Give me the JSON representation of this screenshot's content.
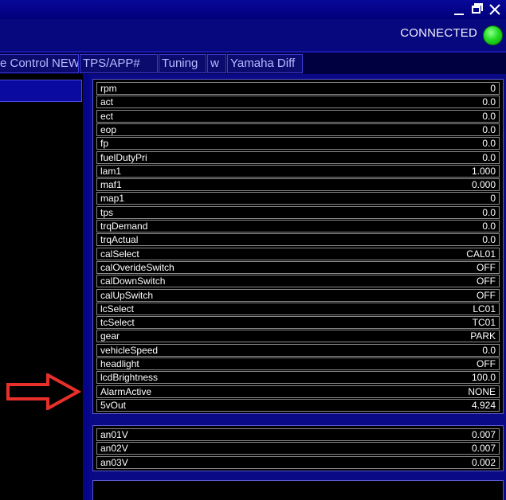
{
  "header": {
    "status_text": "CONNECTED",
    "status_color": "#22dd22"
  },
  "tabs": [
    {
      "label": "e Control NEW"
    },
    {
      "label": "TPS/APP#"
    },
    {
      "label": "Tuning"
    },
    {
      "label": "w"
    },
    {
      "label": "Yamaha Diff"
    }
  ],
  "channels": [
    {
      "name": "rpm",
      "value": "0"
    },
    {
      "name": "act",
      "value": "0.0"
    },
    {
      "name": "ect",
      "value": "0.0"
    },
    {
      "name": "eop",
      "value": "0.0"
    },
    {
      "name": "fp",
      "value": "0.0"
    },
    {
      "name": "fuelDutyPri",
      "value": "0.0"
    },
    {
      "name": "lam1",
      "value": "1.000"
    },
    {
      "name": "maf1",
      "value": "0.000"
    },
    {
      "name": "map1",
      "value": "0"
    },
    {
      "name": "tps",
      "value": "0.0"
    },
    {
      "name": "trqDemand",
      "value": "0.0"
    },
    {
      "name": "trqActual",
      "value": "0.0"
    },
    {
      "name": "calSelect",
      "value": "CAL01"
    },
    {
      "name": "calOverideSwitch",
      "value": "OFF"
    },
    {
      "name": "calDownSwitch",
      "value": "OFF"
    },
    {
      "name": "calUpSwitch",
      "value": "OFF"
    },
    {
      "name": "lcSelect",
      "value": "LC01"
    },
    {
      "name": "tcSelect",
      "value": "TC01"
    },
    {
      "name": "gear",
      "value": "PARK"
    },
    {
      "name": "vehicleSpeed",
      "value": "0.0"
    },
    {
      "name": "headlight",
      "value": "OFF"
    },
    {
      "name": "lcdBrightness",
      "value": "100.0"
    },
    {
      "name": "AlarmActive",
      "value": "NONE"
    },
    {
      "name": "5vOut",
      "value": "4.924"
    }
  ],
  "analog": [
    {
      "name": "an01V",
      "value": "0.007"
    },
    {
      "name": "an02V",
      "value": "0.007"
    },
    {
      "name": "an03V",
      "value": "0.002"
    }
  ],
  "colors": {
    "accent": "#0a0a86",
    "arrow": "#e8302a",
    "text": "#ffffff"
  }
}
